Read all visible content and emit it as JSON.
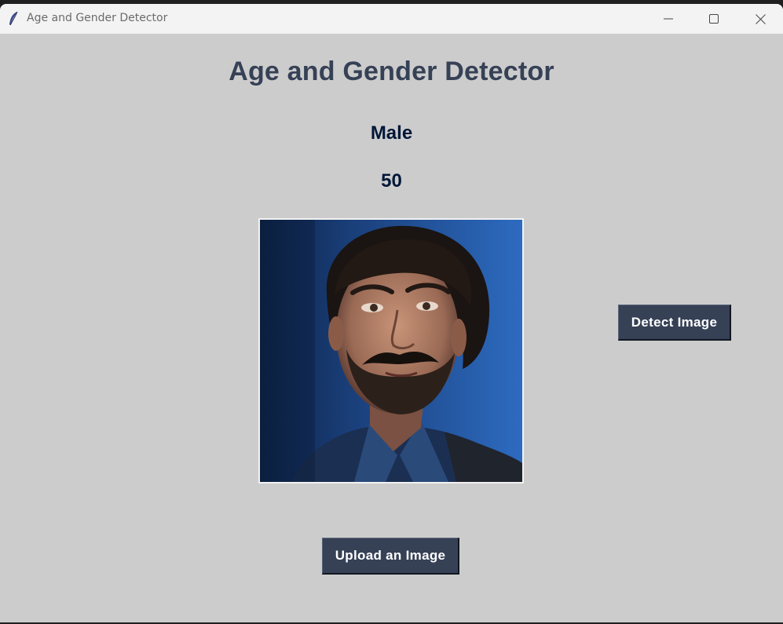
{
  "window": {
    "title": "Age and Gender Detector",
    "app_icon": "feather-icon",
    "controls": [
      "minimize-icon",
      "maximize-icon",
      "close-icon"
    ]
  },
  "main": {
    "heading": "Age and Gender Detector",
    "gender": "Male",
    "age": "50",
    "image": "uploaded-portrait-photo",
    "detect_button": "Detect Image",
    "upload_button": "Upload an Image"
  },
  "colors": {
    "background": "#cccccc",
    "heading": "#364156",
    "result_text": "#011638",
    "button_bg": "#364156",
    "button_text": "#ffffff"
  }
}
